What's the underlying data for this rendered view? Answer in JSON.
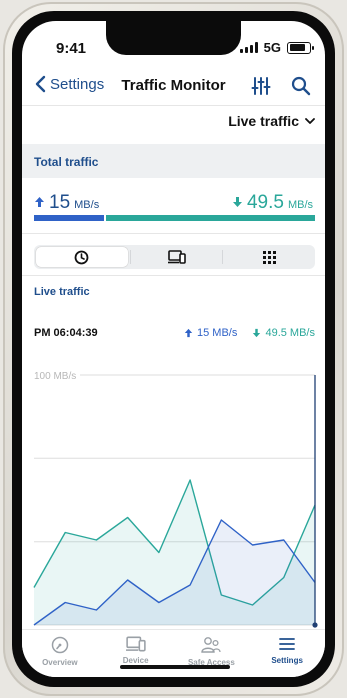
{
  "status": {
    "time": "9:41",
    "network": "5G"
  },
  "nav": {
    "back_label": "Settings",
    "title": "Traffic Monitor",
    "filter_icon": "sliders-icon",
    "search_icon": "search-icon"
  },
  "view_selector": {
    "selected": "Live traffic"
  },
  "total": {
    "section_title": "Total traffic",
    "upload_value": "15",
    "upload_unit": "MB/s",
    "download_value": "49.5",
    "download_unit": "MB/s",
    "upload_fraction": 0.25
  },
  "segments": [
    {
      "icon": "clock-icon",
      "active": true
    },
    {
      "icon": "devices-icon",
      "active": false
    },
    {
      "icon": "grid-icon",
      "active": false
    }
  ],
  "live": {
    "section_title": "Live traffic",
    "cursor_time": "PM 06:04:39",
    "upload": "15 MB/s",
    "download": "49.5 MB/s"
  },
  "chart_data": {
    "type": "area",
    "y_max_label": "100 MB/s",
    "ylim": [
      0,
      100
    ],
    "x": [
      0,
      1,
      2,
      3,
      4,
      5,
      6,
      7,
      8,
      9
    ],
    "series": [
      {
        "values": [
          15,
          37,
          34,
          43,
          29,
          58,
          12,
          8,
          19,
          48
        ]
      },
      {
        "values": [
          0,
          9,
          6,
          18,
          9,
          16,
          42,
          32,
          34,
          17
        ]
      }
    ],
    "cursor_index": 9,
    "grid": true
  },
  "colors": {
    "upload": "#2f62c7",
    "download": "#2aa79a",
    "accent": "#1f4e8c"
  },
  "tabs": [
    {
      "label": "Overview",
      "icon": "gauge-icon",
      "active": false
    },
    {
      "label": "Device",
      "icon": "devices-icon",
      "active": false
    },
    {
      "label": "Safe Access",
      "icon": "users-icon",
      "active": false
    },
    {
      "label": "Settings",
      "icon": "menu-icon",
      "active": true
    }
  ]
}
